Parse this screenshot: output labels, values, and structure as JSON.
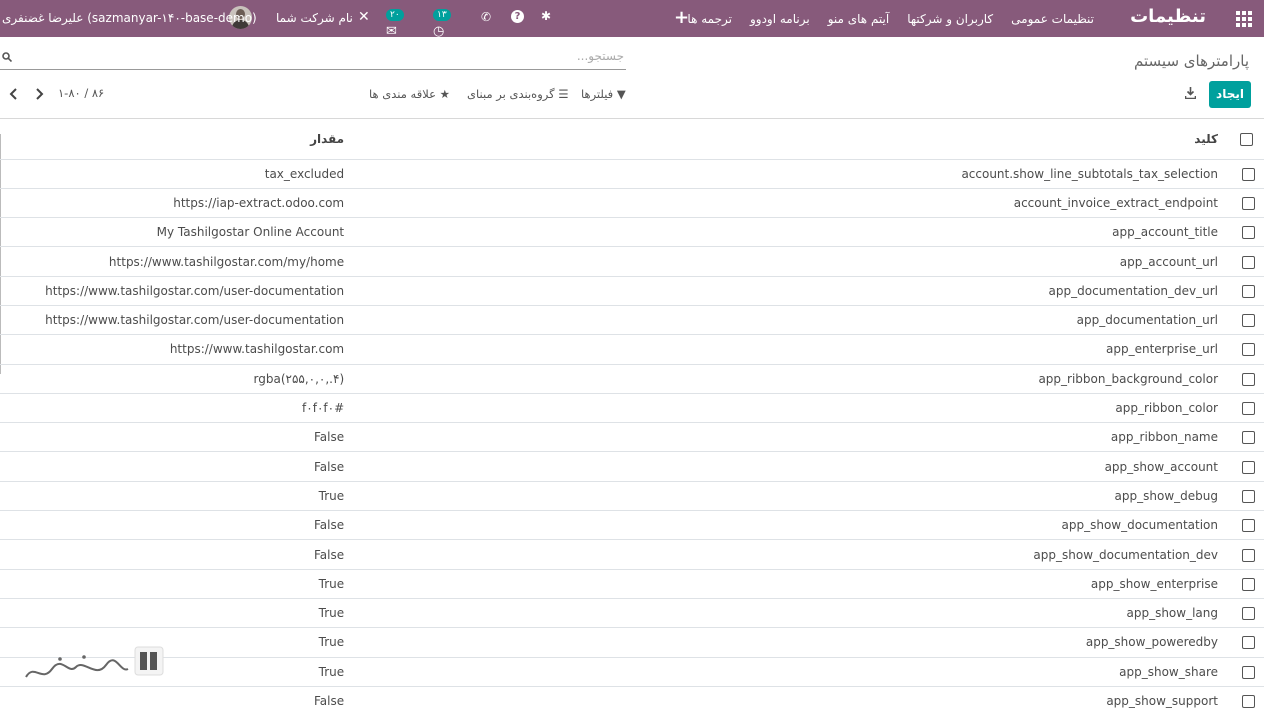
{
  "navbar": {
    "brand": "تنظیمات",
    "menu": [
      "تنظیمات عمومی",
      "کاربران و شرکتها",
      "آیتم های منو",
      "برنامه اودوو",
      "ترجمه ها"
    ],
    "company": "نام شرکت شما",
    "chat_count": "۲۰",
    "activity_count": "۱۳",
    "user": "علیرضا غضنفری (sazmanyar-۱۴۰-base-demo)"
  },
  "control": {
    "breadcrumb": "پارامترهای سیستم",
    "search_placeholder": "جستجو...",
    "create_label": "ایجاد",
    "filters_label": "فیلترها",
    "groupby_label": "گروه‌بندی بر مبنای",
    "favorites_label": "علاقه مندی ها",
    "pager": "۱-۸۰ / ۸۶"
  },
  "table": {
    "headers": {
      "key": "کلید",
      "value": "مقدار"
    },
    "rows": [
      {
        "key": "account.show_line_subtotals_tax_selection",
        "value": "tax_excluded"
      },
      {
        "key": "account_invoice_extract_endpoint",
        "value": "https://iap-extract.odoo.com"
      },
      {
        "key": "app_account_title",
        "value": "My Tashilgostar Online Account"
      },
      {
        "key": "app_account_url",
        "value": "https://www.tashilgostar.com/my/home"
      },
      {
        "key": "app_documentation_dev_url",
        "value": "https://www.tashilgostar.com/user-documentation"
      },
      {
        "key": "app_documentation_url",
        "value": "https://www.tashilgostar.com/user-documentation"
      },
      {
        "key": "app_enterprise_url",
        "value": "https://www.tashilgostar.com"
      },
      {
        "key": "app_ribbon_background_color",
        "value": "rgba(۲۵۵,۰,۰,.۴)"
      },
      {
        "key": "app_ribbon_color",
        "value": "#f۰f۰f۰"
      },
      {
        "key": "app_ribbon_name",
        "value": "False"
      },
      {
        "key": "app_show_account",
        "value": "False"
      },
      {
        "key": "app_show_debug",
        "value": "True"
      },
      {
        "key": "app_show_documentation",
        "value": "False"
      },
      {
        "key": "app_show_documentation_dev",
        "value": "False"
      },
      {
        "key": "app_show_enterprise",
        "value": "True"
      },
      {
        "key": "app_show_lang",
        "value": "True"
      },
      {
        "key": "app_show_poweredby",
        "value": "True"
      },
      {
        "key": "app_show_share",
        "value": "True"
      },
      {
        "key": "app_show_support",
        "value": "False"
      }
    ]
  },
  "colors": {
    "navbar": "#875a7b",
    "primary": "#00a09d"
  },
  "icons": [
    "apps-grid-icon",
    "plus-icon",
    "bug-icon",
    "help-icon",
    "phone-icon",
    "activity-clock-icon",
    "chat-icon",
    "tools-icon",
    "search-icon",
    "download-icon",
    "filter-icon",
    "list-icon",
    "star-icon",
    "chevron-left-icon",
    "chevron-right-icon"
  ]
}
